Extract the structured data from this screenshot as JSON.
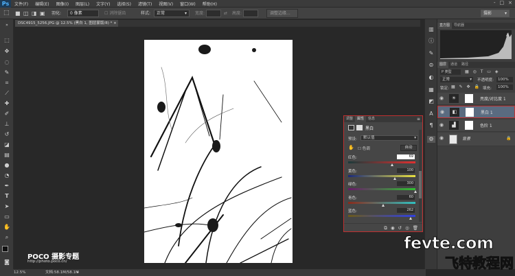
{
  "app": {
    "logo": "Ps"
  },
  "menu": [
    "文件(F)",
    "编辑(E)",
    "图像(I)",
    "图层(L)",
    "文字(Y)",
    "选择(S)",
    "滤镜(T)",
    "视图(V)",
    "窗口(W)",
    "帮助(H)"
  ],
  "window_controls": [
    "-",
    "□",
    "×"
  ],
  "options": {
    "feather_label": "羽化:",
    "feather_value": "0 像素",
    "antialias_label": "消除锯齿",
    "style_label": "样式:",
    "style_value": "正常",
    "width_label": "宽度:",
    "height_label": "高度:",
    "refine_edge": "调整边缘...",
    "workspace": "摄影"
  },
  "document": {
    "tab_title": "DSC4915_5256.JPG @ 12.5% (黑白 1, 图层蒙版/8) *",
    "zoom": "12.5%",
    "doc_size": "文档:58.1M/58.1M"
  },
  "properties": {
    "tabs": [
      "调整",
      "属性",
      "信息"
    ],
    "active_tab": "属性",
    "adjustment_name": "黑白",
    "preset_label": "预设:",
    "preset_value": "默认值",
    "tint_label": "色调",
    "auto_button": "自动",
    "sliders": [
      {
        "label": "红色:",
        "value": "69",
        "fraction": 0.66,
        "gradient": [
          "#1b3a3a",
          "#e03030"
        ]
      },
      {
        "label": "黄色:",
        "value": "100",
        "fraction": 0.7,
        "gradient": [
          "#1a2a7a",
          "#e8e040"
        ]
      },
      {
        "label": "绿色:",
        "value": "300",
        "fraction": 1.0,
        "gradient": [
          "#6a1a6a",
          "#30c030"
        ]
      },
      {
        "label": "青色:",
        "value": "60",
        "fraction": 0.53,
        "gradient": [
          "#8a2a1a",
          "#30c0c0"
        ]
      },
      {
        "label": "蓝色:",
        "value": "262",
        "fraction": 0.93,
        "gradient": [
          "#6a5a1a",
          "#3040e0"
        ]
      }
    ]
  },
  "histogram": {
    "tabs": [
      "直方图",
      "导航器"
    ],
    "active_tab": "直方图"
  },
  "layers_panel": {
    "tabs": [
      "图层",
      "通道",
      "路径"
    ],
    "kind_label": "P 类型",
    "blend_mode": "正常",
    "opacity_label": "不透明度:",
    "opacity": "100%",
    "lock_label": "锁定:",
    "fill_label": "填充:",
    "fill": "100%",
    "layers": [
      {
        "name": "亮度/对比度 1",
        "thumb": "☀",
        "selected": false
      },
      {
        "name": "黑白 1",
        "thumb": "◧",
        "selected": true
      },
      {
        "name": "色阶 1",
        "thumb": "▟",
        "selected": false
      },
      {
        "name": "背景",
        "thumb": "",
        "selected": false
      }
    ]
  },
  "watermarks": {
    "poco": "POCO 摄影专题",
    "poco_url": "http://photo.poco.cn/",
    "fevte": "fevte.com",
    "fevte_cn": "飞特教程网"
  },
  "icons": [
    "marquee-icon",
    "move-icon",
    "lasso-icon",
    "quick-select-icon",
    "crop-icon",
    "eyedropper-icon",
    "healing-icon",
    "brush-icon",
    "stamp-icon",
    "history-brush-icon",
    "eraser-icon",
    "gradient-icon",
    "blur-icon",
    "dodge-icon",
    "pen-icon",
    "type-icon",
    "path-select-icon",
    "shape-icon",
    "hand-icon",
    "zoom-icon"
  ]
}
